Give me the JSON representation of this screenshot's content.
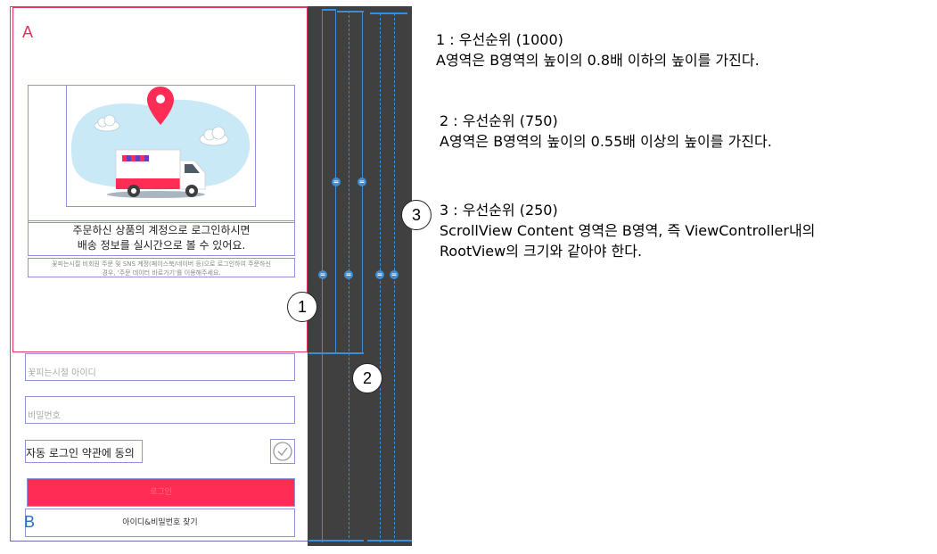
{
  "regions": {
    "a_label": "A",
    "b_label": "B"
  },
  "phone": {
    "headline_line1": "주문하신 상품의 계정으로 로그인하시면",
    "headline_line2": "배송 정보를 실시간으로 볼 수 있어요.",
    "notice_line1": "꽃피는시절 비회원 주문 및 SNS 계정(페이스북/네이버 등)으로 로그인하여 주문하신",
    "notice_line2": "경우, '주문 데이터 바로가기'를 이용해주세요.",
    "id_placeholder": "꽃피는시절 아이디",
    "password_placeholder": "비밀번호",
    "autologin_label": "자동 로그인 약관에 동의",
    "login_button": "로그인",
    "find_link": "아이디&비밀번호 찾기"
  },
  "markers": {
    "m1": "1",
    "m2": "2",
    "m3": "3"
  },
  "constraint_badge": "=",
  "rules": [
    {
      "title": "1 : 우선순위 (1000)",
      "desc": "A영역은 B영역의 높이의 0.8배 이하의 높이를 가진다."
    },
    {
      "title": "2 : 우선순위 (750)",
      "desc": "A영역은 B영역의 높이의 0.55배 이상의 높이를 가진다."
    },
    {
      "title": "3 : 우선순위 (250)",
      "desc": "ScrollView Content 영역은 B영역, 즉 ViewController내의",
      "desc2": "RootView의 크기와 같아야 한다."
    }
  ],
  "colors": {
    "accent_red": "#ff2d55",
    "region_a_border": "#e3335a",
    "constraint_blue": "#3b8ed8",
    "panel_dark": "#404040",
    "outline": "#8f93d8"
  }
}
